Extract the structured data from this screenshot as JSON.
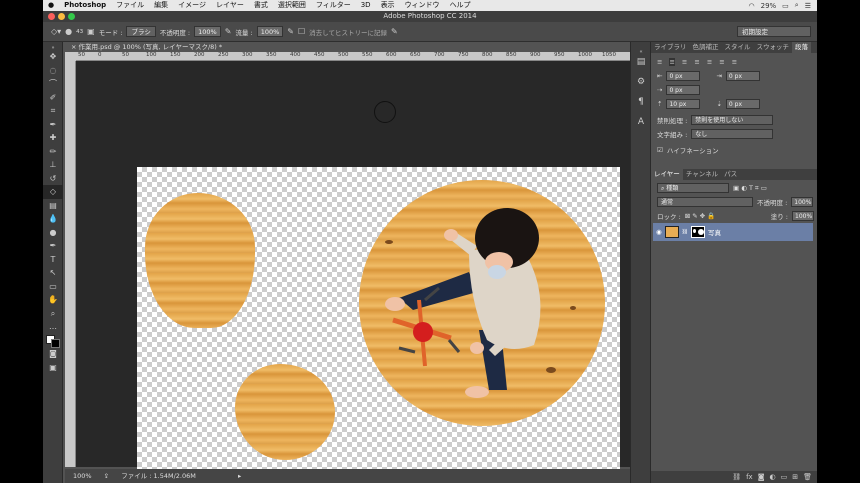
{
  "menubar": {
    "apple": "",
    "items": [
      "Photoshop",
      "ファイル",
      "編集",
      "イメージ",
      "レイヤー",
      "書式",
      "選択範囲",
      "フィルター",
      "3D",
      "表示",
      "ウィンドウ",
      "ヘルプ"
    ],
    "battery": "29%"
  },
  "window": {
    "title": "Adobe Photoshop CC 2014"
  },
  "options": {
    "mode_label": "モード :",
    "mode_value": "ブラシ",
    "opacity_label": "不透明度 :",
    "opacity_value": "100%",
    "flow_label": "流量 :",
    "flow_value": "100%",
    "history_label": "消去してヒストリーに記録",
    "workspace": "初期設定",
    "brush_size": "43"
  },
  "document": {
    "tab": "作業用.psd @ 100% (写真, レイヤーマスク/8) *",
    "zoom": "100%",
    "file_info": "ファイル : 1.54M/2.06M",
    "ruler_ticks": [
      "50",
      "0",
      "50",
      "100",
      "150",
      "200",
      "250",
      "300",
      "350",
      "400",
      "450",
      "500",
      "550",
      "600",
      "650",
      "700",
      "750",
      "800",
      "850",
      "900",
      "950",
      "1000",
      "1050"
    ]
  },
  "paragraph_panel": {
    "tabs": [
      "ライブラリ",
      "色調補正",
      "スタイル",
      "スウォッチ",
      "段落"
    ],
    "indent_left": "0 px",
    "indent_right": "0 px",
    "first_line": "0 px",
    "space_before": "10 px",
    "space_after": "0 px",
    "kinsoku_label": "禁則処理 :",
    "kinsoku_value": "禁則を使用しない",
    "mojikumi_label": "文字組み :",
    "mojikumi_value": "なし",
    "hyphenate": "ハイフネーション"
  },
  "layers_panel": {
    "tabs": [
      "レイヤー",
      "チャンネル",
      "パス"
    ],
    "filter_value": "種類",
    "blend_mode": "通常",
    "opacity_label": "不透明度 :",
    "opacity_value": "100%",
    "lock_label": "ロック :",
    "fill_label": "塗り :",
    "fill_value": "100%",
    "layers": [
      {
        "name": "写真"
      }
    ]
  },
  "colors": {
    "selected_layer": "#6b7fa6",
    "wood": "#e8ad55"
  }
}
